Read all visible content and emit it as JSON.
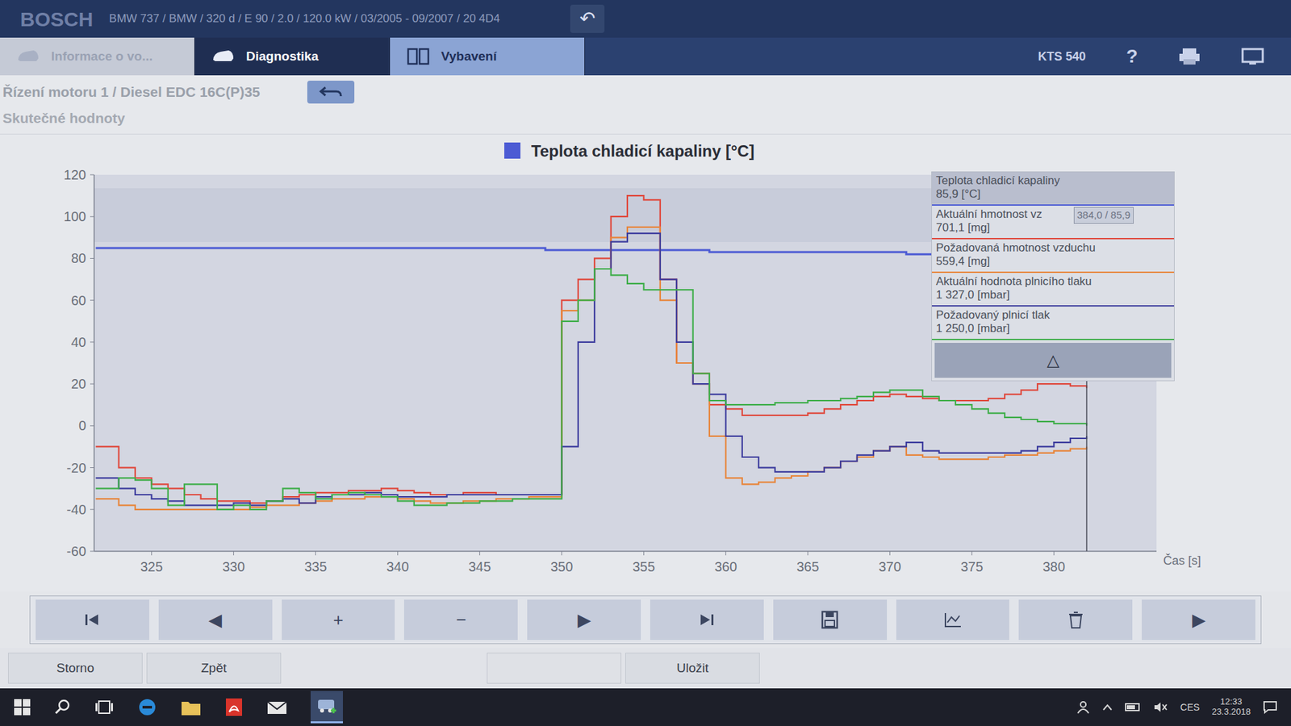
{
  "window": {
    "logo": "BOSCH",
    "title": "BMW 737 / BMW / 320 d / E 90 / 2.0 / 120.0 kW / 03/2005 - 09/2007 / 20 4D4",
    "back": "↶"
  },
  "device": "KTS 540",
  "help": "?",
  "tabs": [
    {
      "label": "Informace o vo...",
      "selected": false
    },
    {
      "label": "Diagnostika",
      "selected": true
    },
    {
      "label": "Vybavení",
      "selected": false
    }
  ],
  "breadcrumb": "Řízení motoru 1 / Diesel EDC 16C(P)35",
  "subtitle": "Skutečné hodnoty",
  "chart": {
    "title": "Teplota chladicí kapaliny [°C]",
    "title_color": "#4c5bd4",
    "y_ticks": [
      "120",
      "100",
      "80",
      "60",
      "40",
      "20",
      "0",
      "-20",
      "-40",
      "-60"
    ],
    "x_ticks": [
      "325",
      "330",
      "335",
      "340",
      "345",
      "350",
      "355",
      "360",
      "365",
      "370",
      "375",
      "380"
    ],
    "x_label": "Čas [s]",
    "time_start": 322,
    "tooltip": "384,0 / 85,9",
    "collapse": "△",
    "series": [
      {
        "label": "Teplota chladicí kapaliny",
        "reading": "85,9 [°C]",
        "color": "#4c5bd4",
        "highlighted": true,
        "values": [
          85,
          85,
          85,
          85,
          85,
          85,
          85,
          85,
          85,
          85,
          85,
          85,
          85,
          85,
          85,
          85,
          85,
          85,
          85,
          85,
          85,
          85,
          85,
          85,
          85,
          85,
          85,
          84,
          84,
          84,
          84,
          84,
          84,
          84,
          84,
          84,
          84,
          83,
          83,
          83,
          83,
          83,
          83,
          83,
          83,
          83,
          83,
          83,
          83,
          82,
          82,
          82,
          82,
          82,
          82,
          82,
          82,
          82,
          82,
          82,
          82
        ]
      },
      {
        "label": "Aktuální hmotnost vz",
        "reading": "701,1 [mg]",
        "color": "#e0483c",
        "highlighted": false,
        "values": [
          -10,
          -20,
          -25,
          -28,
          -30,
          -33,
          -35,
          -36,
          -36,
          -37,
          -36,
          -34,
          -33,
          -32,
          -32,
          -31,
          -31,
          -30,
          -31,
          -32,
          -33,
          -33,
          -32,
          -32,
          -33,
          -33,
          -33,
          -33,
          60,
          70,
          80,
          100,
          110,
          108,
          70,
          30,
          25,
          10,
          8,
          5,
          5,
          5,
          5,
          6,
          8,
          10,
          12,
          14,
          15,
          14,
          13,
          12,
          12,
          12,
          13,
          15,
          17,
          20,
          20,
          19,
          18
        ]
      },
      {
        "label": "Požadovaná hmotnost vzduchu",
        "reading": "559,4 [mg]",
        "color": "#e8853a",
        "highlighted": false,
        "values": [
          -35,
          -38,
          -40,
          -40,
          -40,
          -40,
          -40,
          -40,
          -40,
          -39,
          -38,
          -38,
          -37,
          -36,
          -35,
          -35,
          -34,
          -34,
          -35,
          -36,
          -37,
          -37,
          -36,
          -36,
          -35,
          -35,
          -34,
          -34,
          55,
          60,
          75,
          90,
          95,
          95,
          60,
          30,
          20,
          -5,
          -25,
          -28,
          -27,
          -25,
          -24,
          -22,
          -20,
          -17,
          -15,
          -12,
          -10,
          -14,
          -15,
          -16,
          -16,
          -16,
          -15,
          -14,
          -14,
          -13,
          -12,
          -11,
          -10
        ]
      },
      {
        "label": "Aktuální hodnota plnicího tlaku",
        "reading": "1 327,0 [mbar]",
        "color": "#3d3d9e",
        "highlighted": false,
        "values": [
          -25,
          -30,
          -33,
          -35,
          -36,
          -38,
          -38,
          -38,
          -37,
          -38,
          -36,
          -35,
          -37,
          -34,
          -33,
          -33,
          -32,
          -33,
          -34,
          -34,
          -34,
          -33,
          -33,
          -33,
          -33,
          -33,
          -33,
          -33,
          -10,
          40,
          75,
          88,
          92,
          92,
          70,
          40,
          20,
          15,
          -5,
          -15,
          -20,
          -22,
          -22,
          -22,
          -20,
          -17,
          -14,
          -12,
          -10,
          -8,
          -12,
          -13,
          -13,
          -13,
          -13,
          -13,
          -12,
          -10,
          -8,
          -6,
          -5
        ]
      },
      {
        "label": "Požadovaný plnicí tlak",
        "reading": "1 250,0 [mbar]",
        "color": "#3fae4a",
        "highlighted": false,
        "values": [
          -30,
          -25,
          -26,
          -30,
          -38,
          -28,
          -28,
          -40,
          -38,
          -40,
          -36,
          -30,
          -32,
          -35,
          -33,
          -32,
          -33,
          -34,
          -36,
          -38,
          -38,
          -37,
          -37,
          -36,
          -36,
          -35,
          -35,
          -35,
          50,
          60,
          75,
          72,
          68,
          65,
          65,
          65,
          25,
          12,
          10,
          10,
          10,
          11,
          11,
          12,
          12,
          13,
          14,
          16,
          17,
          17,
          14,
          12,
          10,
          8,
          6,
          4,
          3,
          2,
          1,
          1,
          0
        ]
      }
    ]
  },
  "toolbar": [
    {
      "kind": "icon"
    },
    {
      "kind": "text",
      "label": "◀"
    },
    {
      "kind": "text",
      "label": "+"
    },
    {
      "kind": "text",
      "label": "−"
    },
    {
      "kind": "text",
      "label": "▶"
    },
    {
      "kind": "icon"
    },
    {
      "kind": "icon"
    },
    {
      "kind": "icon"
    },
    {
      "kind": "icon"
    },
    {
      "kind": "text",
      "label": "▶"
    }
  ],
  "buttons": [
    {
      "label": "Storno",
      "disabled": false
    },
    {
      "label": "Zpět",
      "disabled": false
    },
    {
      "label": "",
      "disabled": true
    },
    {
      "label": "Uložit",
      "disabled": false
    }
  ],
  "taskbar": {
    "language": "CES",
    "time": "12:33",
    "date": "23.3.2018"
  }
}
